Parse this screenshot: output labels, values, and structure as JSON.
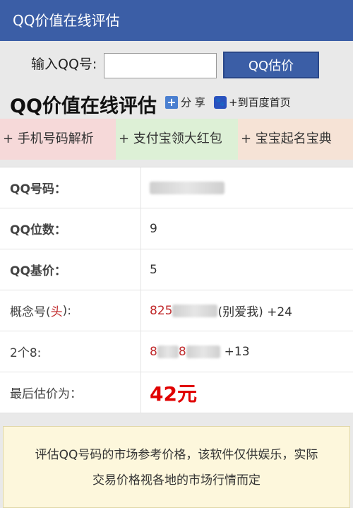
{
  "header": {
    "title": "QQ价值在线评估"
  },
  "search": {
    "label": "输入QQ号:",
    "input_value": "",
    "button_label": "QQ估价"
  },
  "title_row": {
    "title": "QQ价值在线评估",
    "share_label": "分 享",
    "baidu_label": "+到百度首页"
  },
  "links": [
    {
      "label": "+ 手机号码解析"
    },
    {
      "label": "+ 支付宝领大红包"
    },
    {
      "label": "+ 宝宝起名宝典"
    }
  ],
  "table": {
    "rows": [
      {
        "label": "QQ号码："
      },
      {
        "label": "QQ位数：",
        "value": "9"
      },
      {
        "label": "QQ基价：",
        "value": "5"
      },
      {
        "label_prefix": "概念号(",
        "label_red": "头",
        "label_suffix": "):",
        "value_red": "825",
        "value_tail": "(别爱我) +24"
      },
      {
        "label": "2个8:",
        "value_red_a": "8",
        "value_red_b": "8",
        "value_tail": "+13"
      },
      {
        "label": "最后估价为：",
        "value": "42元"
      }
    ]
  },
  "notice": {
    "line1": "评估QQ号码的市场参考价格，该软件仅供娱乐，实际",
    "line2": "交易价格视各地的市场行情而定"
  }
}
